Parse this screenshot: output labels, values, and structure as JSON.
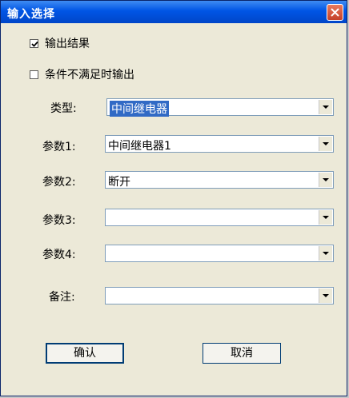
{
  "window": {
    "title": "输入选择"
  },
  "checkboxes": [
    {
      "label": "输出结果",
      "checked": true
    },
    {
      "label": "条件不满足时输出",
      "checked": false
    }
  ],
  "fields": [
    {
      "label": "类型:",
      "value": "中间继电器"
    },
    {
      "label": "参数1:",
      "value": "中间继电器1"
    },
    {
      "label": "参数2:",
      "value": "断开"
    },
    {
      "label": "参数3:",
      "value": ""
    },
    {
      "label": "参数4:",
      "value": ""
    },
    {
      "label": "备注:",
      "value": ""
    }
  ],
  "buttons": {
    "ok": "确认",
    "cancel": "取消"
  },
  "colors": {
    "titlebar": "#0055e5",
    "selection": "#316ac5",
    "face": "#ece9d8"
  },
  "icons": {
    "close": "close-icon",
    "dropdown": "chevron-down-icon",
    "check": "checkmark-icon"
  }
}
